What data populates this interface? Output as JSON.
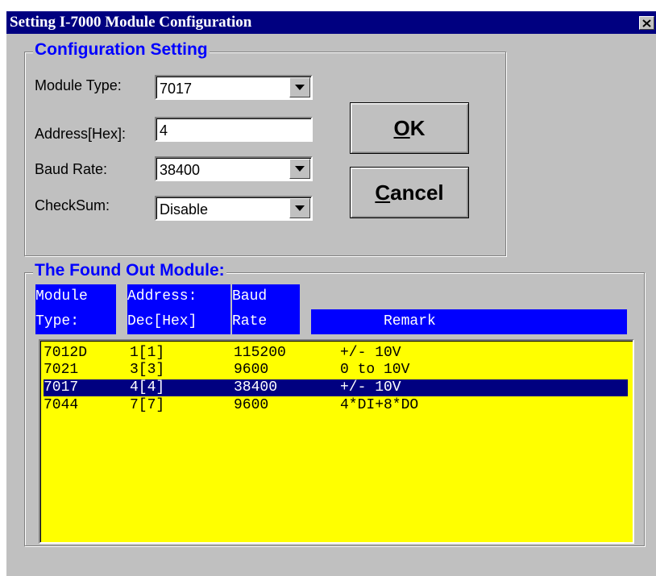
{
  "window": {
    "title": "Setting I-7000 Module Configuration"
  },
  "config": {
    "group_title": "Configuration Setting",
    "module_type_label": "Module Type:",
    "module_type_value": "7017",
    "address_label": "Address[Hex]:",
    "address_value": "4",
    "baud_label": "Baud Rate:",
    "baud_value": "38400",
    "checksum_label": "CheckSum:",
    "checksum_value": "Disable"
  },
  "buttons": {
    "ok": {
      "mnemonic": "O",
      "rest": "K"
    },
    "cancel": {
      "mnemonic": "C",
      "rest": "ancel"
    }
  },
  "found": {
    "group_title": "The Found Out Module:",
    "headers": {
      "type_1": "Module",
      "type_2": "Type:",
      "addr_1": "Address:",
      "addr_2": "Dec[Hex]",
      "baud_1": "Baud",
      "baud_2": "Rate",
      "remark": "Remark"
    },
    "rows": [
      {
        "type": "7012D",
        "address": "1[1]",
        "baud": "115200",
        "remark": "+/- 10V"
      },
      {
        "type": "7021",
        "address": "3[3]",
        "baud": "9600",
        "remark": "0 to 10V"
      },
      {
        "type": "7017",
        "address": "4[4]",
        "baud": "38400",
        "remark": "+/- 10V"
      },
      {
        "type": "7044",
        "address": "7[7]",
        "baud": "9600",
        "remark": "4*DI+8*DO"
      }
    ],
    "selected_row": 3
  },
  "icons": {
    "close": "close-icon",
    "dropdown": "dropdown-arrow-icon"
  },
  "colors": {
    "titlebar": "#000080",
    "group_title": "#0000ff",
    "header_bg": "#0000ff",
    "list_bg": "#ffff00",
    "selection": "#000080"
  }
}
